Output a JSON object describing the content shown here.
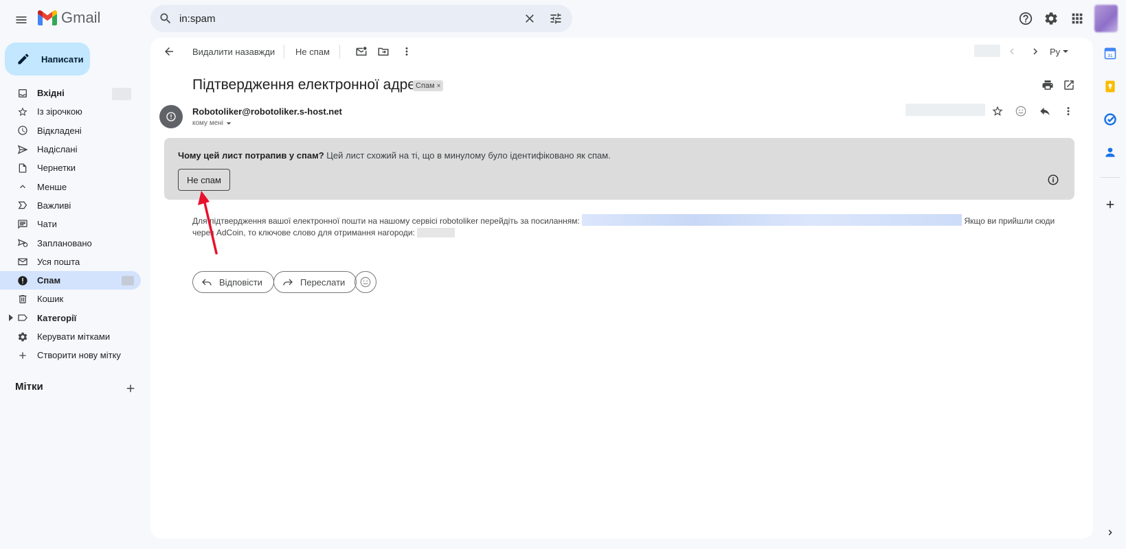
{
  "app": {
    "logo_text": "Gmail"
  },
  "search": {
    "value": "in:spam"
  },
  "sidebar": {
    "compose_label": "Написати",
    "items": [
      {
        "label": "Вхідні",
        "icon": "inbox-icon"
      },
      {
        "label": "Із зірочкою",
        "icon": "star-icon"
      },
      {
        "label": "Відкладені",
        "icon": "clock-icon"
      },
      {
        "label": "Надіслані",
        "icon": "send-icon"
      },
      {
        "label": "Чернетки",
        "icon": "draft-icon"
      },
      {
        "label": "Менше",
        "icon": "chevron-up-icon"
      },
      {
        "label": "Важливі",
        "icon": "important-icon"
      },
      {
        "label": "Чати",
        "icon": "chat-icon"
      },
      {
        "label": "Заплановано",
        "icon": "scheduled-icon"
      },
      {
        "label": "Уся пошта",
        "icon": "all-mail-icon"
      },
      {
        "label": "Спам",
        "icon": "spam-icon"
      },
      {
        "label": "Кошик",
        "icon": "trash-icon"
      },
      {
        "label": "Категорії",
        "icon": "label-icon"
      },
      {
        "label": "Керувати мітками",
        "icon": "gear-icon"
      },
      {
        "label": "Створити нову мітку",
        "icon": "plus-icon"
      }
    ],
    "labels_heading": "Мітки"
  },
  "toolbar": {
    "delete_forever_label": "Видалити назавжди",
    "not_spam_label": "Не спам",
    "sort_label": "Ру"
  },
  "email": {
    "subject": "Підтвердження електронної адреси",
    "spam_chip": "Спам",
    "sender": "Robotoliker@robotoliker.s-host.net",
    "to_me": "кому мені",
    "warning_title": "Чому цей лист потрапив у спам?",
    "warning_text": "Цей лист схожий на ті, що в минулому було ідентифіковано як спам.",
    "not_spam_button": "Не спам",
    "body_part1": "Для підтвердження вашої електронної пошти на нашому сервісі robotoliker перейдіть за посиланням:",
    "body_part2": "Якщо ви прийшли сюди через AdCoin, то ключове слово для отримання нагороди:",
    "reply_label": "Відповісти",
    "forward_label": "Переслати"
  },
  "colors": {
    "accent_compose": "#c2e7ff",
    "active_nav": "#d3e3fd",
    "arrow": "#e8112d"
  }
}
